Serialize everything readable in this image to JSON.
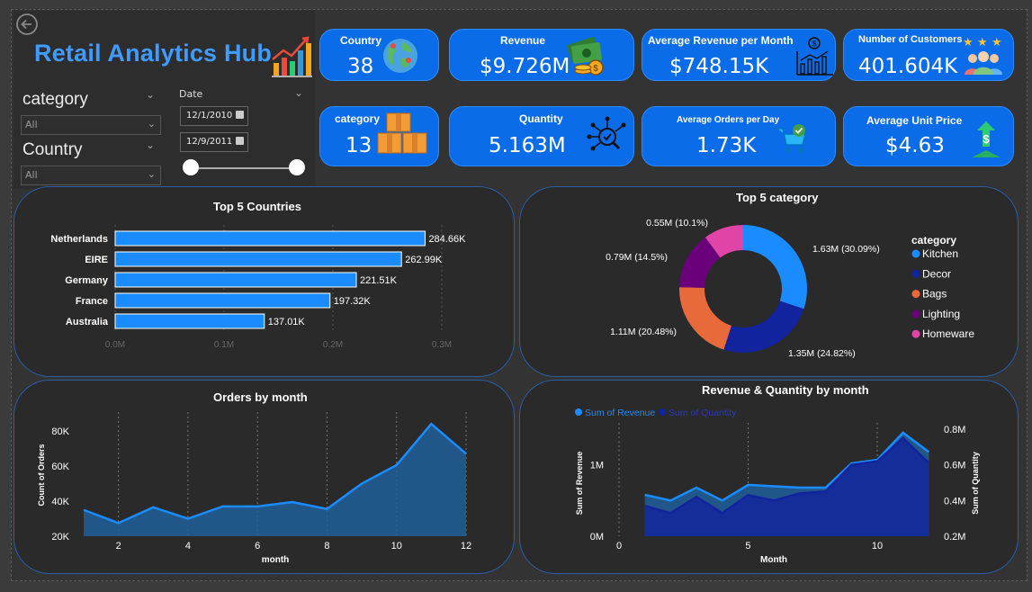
{
  "header": {
    "title": "Retail Analytics Hub",
    "back_icon": "arrow-left-circle-icon",
    "title_icon": "bar-chart-growth-icon"
  },
  "filters": {
    "category": {
      "label": "category",
      "selected": "All"
    },
    "country": {
      "label": "Country",
      "selected": "All"
    },
    "date": {
      "label": "Date",
      "start": "12/1/2010",
      "end": "12/9/2011"
    }
  },
  "kpis": {
    "country": {
      "label": "Country",
      "value": "38",
      "icon": "globe-icon"
    },
    "revenue": {
      "label": "Revenue",
      "value": "$9.726M",
      "icon": "money-cash-icon"
    },
    "avg_revenue_month": {
      "label": "Average Revenue per Month",
      "value": "$748.15K",
      "icon": "money-growth-chart-icon"
    },
    "customers": {
      "label": "Number of Customers",
      "value": "401.604K",
      "icon": "customers-stars-icon"
    },
    "category": {
      "label": "category",
      "value": "13",
      "icon": "boxes-icon"
    },
    "quantity": {
      "label": "Quantity",
      "value": "5.163M",
      "icon": "network-analysis-icon"
    },
    "avg_orders_day": {
      "label": "Average Orders per Day",
      "value": "1.73K",
      "icon": "shopping-cart-check-icon"
    },
    "avg_unit_price": {
      "label": "Average Unit Price",
      "value": "$4.63",
      "icon": "dollar-growth-icon"
    }
  },
  "colors": {
    "accent": "#0a6ce8",
    "bar": "#1a8cff",
    "kitchen": "#1a8cff",
    "decor": "#12239e",
    "bags": "#e8693a",
    "lighting": "#6b007b",
    "homeware": "#e044a7"
  },
  "chart_data": [
    {
      "id": "top5-countries",
      "type": "bar",
      "title": "Top 5 Countries",
      "categories": [
        "Netherlands",
        "EIRE",
        "Germany",
        "France",
        "Australia"
      ],
      "values": [
        284.66,
        262.99,
        221.51,
        197.32,
        137.01
      ],
      "value_labels": [
        "284.66K",
        "262.99K",
        "221.51K",
        "197.32K",
        "137.01K"
      ],
      "x_ticks": [
        "0.0M",
        "0.1M",
        "0.2M",
        "0.3M"
      ],
      "xlim": [
        0,
        300
      ],
      "unit": "K",
      "grid": true
    },
    {
      "id": "top5-category",
      "type": "pie",
      "title": "Top 5 category",
      "legend_title": "category",
      "legend_position": "right",
      "labels": [
        "Kitchen",
        "Decor",
        "Bags",
        "Lighting",
        "Homeware"
      ],
      "values": [
        30.09,
        24.82,
        20.48,
        14.5,
        10.1
      ],
      "value_labels": [
        "1.63M (30.09%)",
        "1.35M (24.82%)",
        "1.11M (20.48%)",
        "0.79M (14.5%)",
        "0.55M (10.1%)"
      ]
    },
    {
      "id": "orders-by-month",
      "type": "area",
      "title": "Orders by month",
      "xlabel": "month",
      "ylabel": "Count of Orders",
      "x": [
        1,
        2,
        3,
        4,
        5,
        6,
        7,
        8,
        9,
        10,
        11,
        12
      ],
      "values": [
        35000,
        27500,
        36500,
        30000,
        37000,
        37000,
        39500,
        35500,
        50000,
        60500,
        84000,
        67000
      ],
      "x_ticks": [
        "2",
        "4",
        "6",
        "8",
        "10",
        "12"
      ],
      "y_ticks": [
        "20K",
        "40K",
        "60K",
        "80K"
      ],
      "ylim": [
        20000,
        80000
      ],
      "grid": true
    },
    {
      "id": "revenue-quantity-by-month",
      "type": "area",
      "title": "Revenue & Quantity by month",
      "xlabel": "Month",
      "ylabel": "Sum of Revenue",
      "ylabel_right": "Sum of Quantity",
      "legend_position": "top-left",
      "x": [
        1,
        2,
        3,
        4,
        5,
        6,
        7,
        8,
        9,
        10,
        11,
        12
      ],
      "series": [
        {
          "name": "Sum of Revenue",
          "axis": "left",
          "values": [
            0.58,
            0.5,
            0.68,
            0.5,
            0.72,
            0.7,
            0.68,
            0.68,
            1.02,
            1.07,
            1.45,
            1.18
          ]
        },
        {
          "name": "Sum of Quantity",
          "axis": "right",
          "values": [
            0.37,
            0.33,
            0.42,
            0.33,
            0.43,
            0.4,
            0.44,
            0.45,
            0.6,
            0.62,
            0.75,
            0.61
          ]
        }
      ],
      "x_ticks": [
        "0",
        "5",
        "10"
      ],
      "y_ticks": [
        "0M",
        "1M"
      ],
      "y_ticks_right": [
        "0.2M",
        "0.4M",
        "0.6M",
        "0.8M"
      ],
      "ylim": [
        0,
        1.5
      ],
      "ylim_right": [
        0.2,
        0.8
      ],
      "xlim": [
        0,
        12.3
      ],
      "grid": true
    }
  ]
}
